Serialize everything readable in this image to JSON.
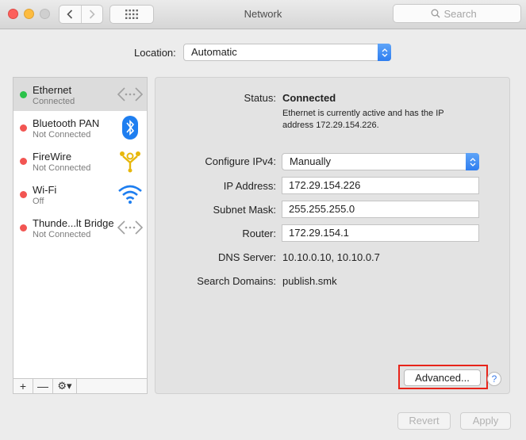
{
  "window": {
    "title": "Network"
  },
  "search": {
    "placeholder": "Search"
  },
  "location": {
    "label": "Location:",
    "value": "Automatic"
  },
  "services": [
    {
      "name": "Ethernet",
      "status": "Connected",
      "state": "green",
      "icon": "ethernet-icon",
      "selected": true
    },
    {
      "name": "Bluetooth PAN",
      "status": "Not Connected",
      "state": "red",
      "icon": "bluetooth-icon"
    },
    {
      "name": "FireWire",
      "status": "Not Connected",
      "state": "red",
      "icon": "firewire-icon"
    },
    {
      "name": "Wi-Fi",
      "status": "Off",
      "state": "red",
      "icon": "wifi-icon"
    },
    {
      "name": "Thunde...lt Bridge",
      "status": "Not Connected",
      "state": "red",
      "icon": "thunderbolt-bridge-icon"
    }
  ],
  "sidebar_toolbar": {
    "add": "+",
    "remove": "—",
    "action": "⚙▾"
  },
  "details": {
    "status_label": "Status:",
    "status_value": "Connected",
    "status_description": "Ethernet is currently active and has the IP address 172.29.154.226.",
    "configure_label": "Configure IPv4:",
    "configure_value": "Manually",
    "ip_label": "IP Address:",
    "ip_value": "172.29.154.226",
    "subnet_label": "Subnet Mask:",
    "subnet_value": "255.255.255.0",
    "router_label": "Router:",
    "router_value": "172.29.154.1",
    "dns_label": "DNS Server:",
    "dns_value": "10.10.0.10, 10.10.0.7",
    "search_domains_label": "Search Domains:",
    "search_domains_value": "publish.smk"
  },
  "buttons": {
    "advanced": "Advanced...",
    "help": "?",
    "revert": "Revert",
    "apply": "Apply"
  },
  "colors": {
    "accent": "#2f7ef0",
    "connected": "#2bc24a",
    "disconnected": "#f25552",
    "highlight": "#e8241a"
  }
}
